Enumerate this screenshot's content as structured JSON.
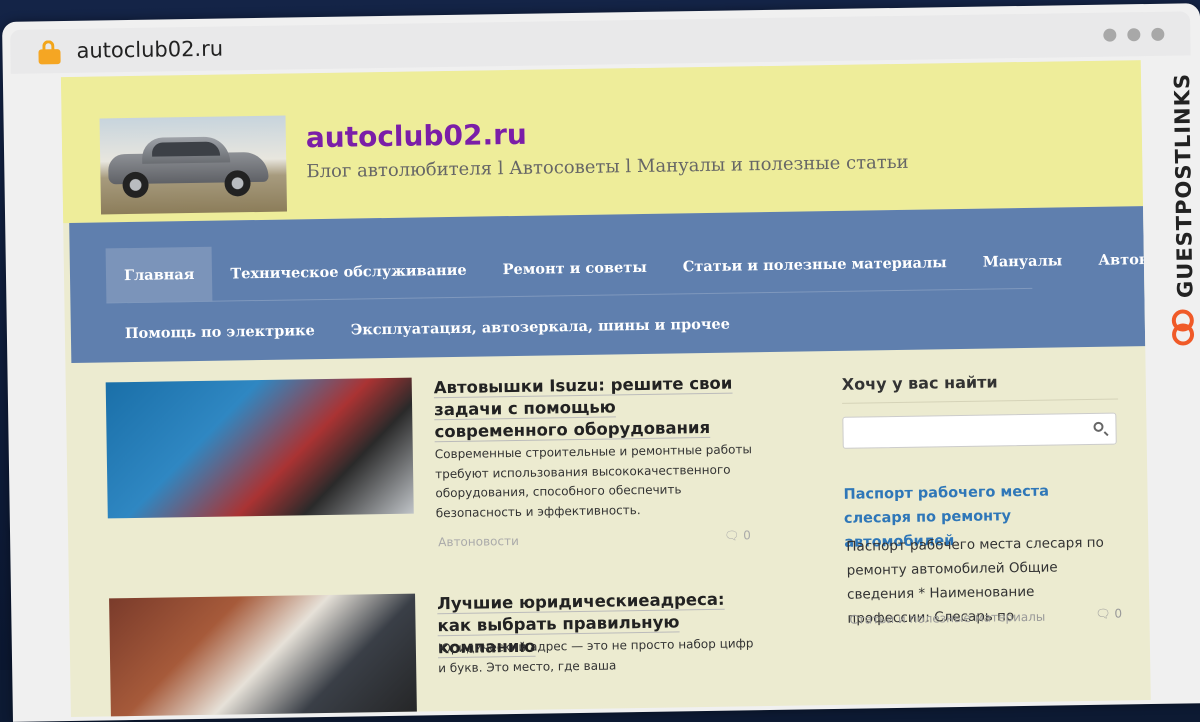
{
  "browser": {
    "url": "autoclub02.ru"
  },
  "header": {
    "title": "autoclub02.ru",
    "description": "Блог автолюбителя l Автосоветы l Мануалы и полезные статьи"
  },
  "nav": {
    "row1": [
      "Главная",
      "Техническое обслуживание",
      "Ремонт и советы",
      "Статьи и полезные материалы",
      "Мануалы",
      "Автоновости"
    ],
    "row2": [
      "Помощь по электрике",
      "Эксплуатация, автозеркала, шины и прочее"
    ]
  },
  "posts": [
    {
      "title": "Автовышки Isuzu: решите свои задачи с помощью современного оборудования",
      "excerpt": "Современные строительные и ремонтные работы требуют использования высококачественного оборудования, способного обеспечить безопасность и эффективность.",
      "category": "Автоновости",
      "comments": "0"
    },
    {
      "title": "Лучшие юридическиеадреса: как выбрать правильную компанию",
      "excerpt": "Юридический адрес — это не просто набор цифр и букв. Это место, где ваша"
    }
  ],
  "sidebar": {
    "widget_title": "Хочу у вас найти",
    "search_placeholder": "",
    "featured": {
      "title": "Паспорт рабочего места слесаря по ремонту автомобилей",
      "excerpt": "Паспорт рабочего места слесаря по ремонту автомобилей Общие сведения * Наименование профессии: Слесарь по",
      "category": "Статьи и полезные материалы",
      "comments": "0"
    }
  },
  "brand": {
    "name": "GUESTPOSTLINKS"
  },
  "colors": {
    "header_bg": "#eeed9a",
    "nav_bg": "#5f7fae",
    "title_purple": "#7b1ea8",
    "link_blue": "#2f77b8",
    "brand_orange": "#f05a28"
  }
}
